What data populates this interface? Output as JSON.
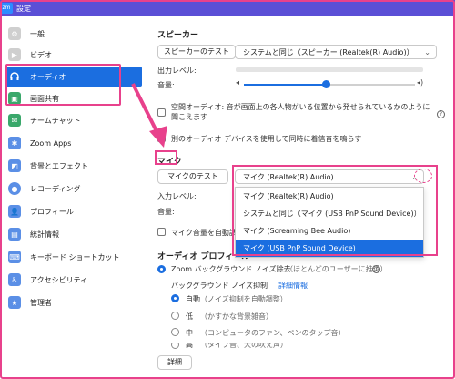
{
  "window": {
    "title": "設定",
    "logo": "zoom"
  },
  "sidebar": {
    "items": [
      {
        "label": "一般",
        "icon": "gear-icon",
        "color": "#c8c8c8"
      },
      {
        "label": "ビデオ",
        "icon": "video-icon",
        "color": "#c8c8c8"
      },
      {
        "label": "オーディオ",
        "icon": "headphones-icon",
        "color": "#ffffff",
        "active": true
      },
      {
        "label": "画面共有",
        "icon": "screen-share-icon",
        "color": "#3aa86b"
      },
      {
        "label": "チームチャット",
        "icon": "chat-icon",
        "color": "#3aa86b"
      },
      {
        "label": "Zoom Apps",
        "icon": "apps-icon",
        "color": "#5b8fe6"
      },
      {
        "label": "背景とエフェクト",
        "icon": "background-icon",
        "color": "#5b8fe6"
      },
      {
        "label": "レコーディング",
        "icon": "record-icon",
        "color": "#5b8fe6"
      },
      {
        "label": "プロフィール",
        "icon": "profile-icon",
        "color": "#5b8fe6"
      },
      {
        "label": "統計情報",
        "icon": "stats-icon",
        "color": "#5b8fe6"
      },
      {
        "label": "キーボード ショートカット",
        "icon": "keyboard-icon",
        "color": "#5b8fe6"
      },
      {
        "label": "アクセシビリティ",
        "icon": "accessibility-icon",
        "color": "#5b8fe6"
      },
      {
        "label": "管理者",
        "icon": "admin-icon",
        "color": "#5b8fe6"
      }
    ]
  },
  "speaker": {
    "section_title": "スピーカー",
    "test_button": "スピーカーのテスト",
    "device_select": "システムと同じ（スピーカー (Realtek(R) Audio)）",
    "output_level_label": "出力レベル:",
    "volume_label": "音量:",
    "volume_level": 0.48,
    "spatial_audio_text": "空間オーディオ: 音が画面上の各人物がいる位置から発せられているかのように聞こえます",
    "separate_device_text": "別のオーディオ デバイスを使用して同時に着信音を鳴らす"
  },
  "mic": {
    "section_title": "マイク",
    "test_button": "マイクのテスト",
    "device_select": "マイク (Realtek(R) Audio)",
    "input_level_label": "入力レベル:",
    "volume_label": "音量:",
    "auto_adjust_text": "マイク音量を自動調",
    "dropdown_options": [
      {
        "label": "マイク (Realtek(R) Audio)",
        "selected": false
      },
      {
        "label": "システムと同じ（マイク (USB PnP Sound Device)）",
        "selected": false
      },
      {
        "label": "マイク (Screaming Bee Audio)",
        "selected": false
      },
      {
        "label": "マイク (USB PnP Sound Device)",
        "selected": true
      }
    ]
  },
  "audio_profile": {
    "section_title": "オーディオ プロフィール",
    "zoom_noise_text": "Zoom バックグラウンド ノイズ除去",
    "zoom_noise_note": "（ほとんどのユーザーに推奨）",
    "bg_noise_label": "バックグラウンド ノイズ抑制",
    "details_link": "詳細情報",
    "options": [
      {
        "label": "自動",
        "note": "（ノイズ抑制を自動調整）",
        "selected": true
      },
      {
        "label": "低",
        "note": "（かすかな背景雑音）",
        "selected": false
      },
      {
        "label": "中",
        "note": "（コンピュータのファン、ペンのタップ音）",
        "selected": false
      },
      {
        "label": "高",
        "note": "（タイプ音、犬の吠え声）",
        "selected": false
      }
    ]
  },
  "footer": {
    "advanced_button": "詳細"
  },
  "colors": {
    "accent": "#1b6ee0",
    "annotation": "#e8418c",
    "titlebar": "#5b4fd6"
  }
}
